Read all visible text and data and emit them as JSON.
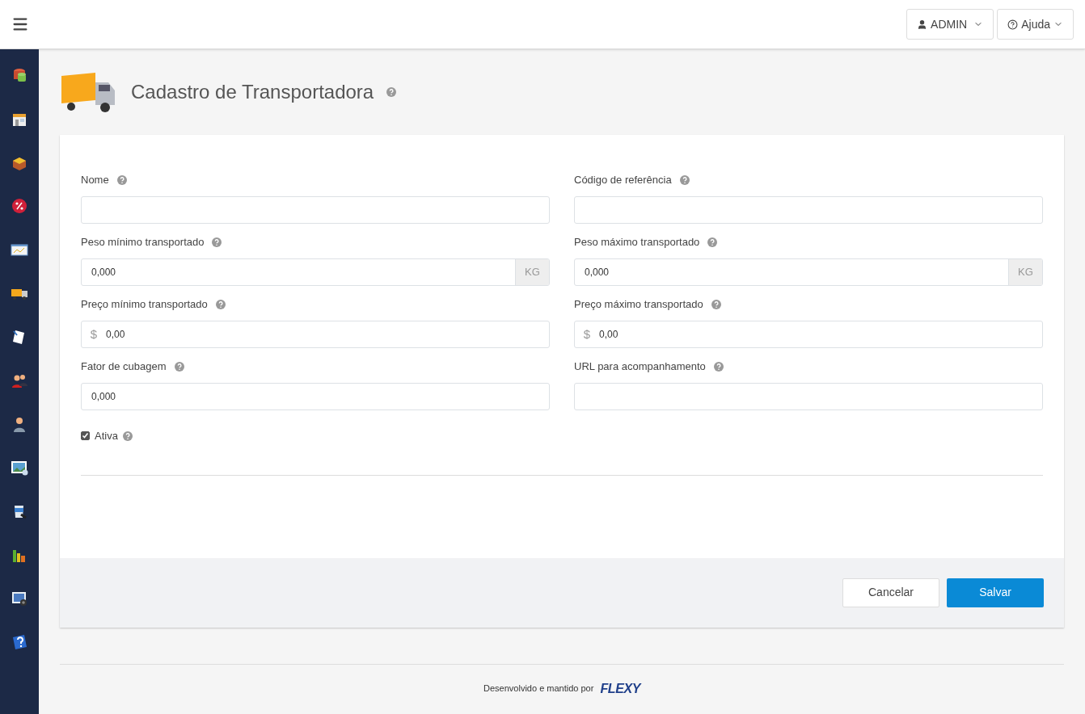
{
  "topbar": {
    "user_menu": "ADMIN",
    "help_menu": "Ajuda"
  },
  "page": {
    "title": "Cadastro de Transportadora"
  },
  "form": {
    "fields": [
      {
        "label": "Nome",
        "kind": "plain"
      },
      {
        "label": "Código de referência",
        "kind": "plain"
      },
      {
        "label": "Peso mínimo transportado",
        "kind": "suffix",
        "value": "0,000",
        "addon": "KG"
      },
      {
        "label": "Peso máximo transportado",
        "kind": "suffix",
        "value": "0,000",
        "addon": "KG"
      },
      {
        "label": "Preço mínimo transportado",
        "kind": "prefix",
        "value": "0,00",
        "addon": "$"
      },
      {
        "label": "Preço máximo transportado",
        "kind": "prefix",
        "value": "0,00",
        "addon": "$"
      },
      {
        "label": "Fator de cubagem",
        "kind": "plain",
        "value": "0,000"
      },
      {
        "label": "URL para acompanhamento",
        "kind": "plain"
      }
    ],
    "active": {
      "label": "Ativa",
      "checked": true
    },
    "buttons": [
      {
        "label": "Cancelar",
        "kind": "default"
      },
      {
        "label": "Salvar",
        "kind": "primary"
      }
    ]
  },
  "footer": {
    "text": "Desenvolvido e mantido por",
    "logo": "FLEXY"
  }
}
